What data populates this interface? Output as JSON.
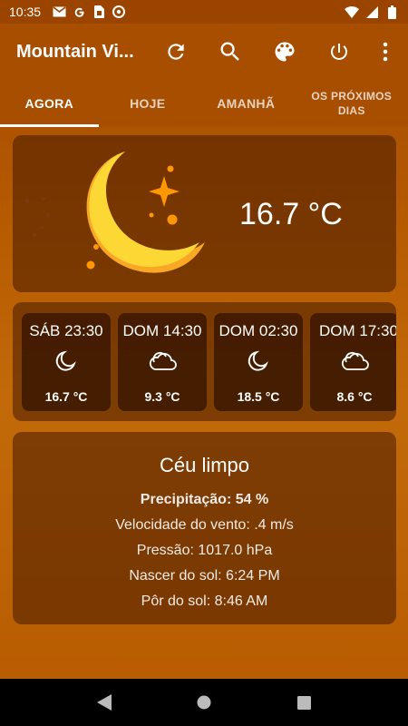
{
  "status_bar": {
    "time": "10:35",
    "icons": [
      "gmail-icon",
      "google-icon",
      "sim-card-icon",
      "do-not-disturb-icon"
    ],
    "right_icons": [
      "wifi-icon",
      "signal-icon",
      "battery-icon"
    ]
  },
  "app_bar": {
    "title": "Mountain Vi...",
    "actions": [
      "refresh-icon",
      "search-icon",
      "palette-icon",
      "power-icon",
      "more-vert-icon"
    ]
  },
  "tabs": [
    {
      "label": "AGORA",
      "active": true
    },
    {
      "label": "HOJE",
      "active": false
    },
    {
      "label": "AMANHÃ",
      "active": false
    },
    {
      "label": "OS PRÓXIMOS DIAS",
      "active": false
    }
  ],
  "current": {
    "icon": "moon-stars-icon",
    "temperature": "16.7 °C"
  },
  "forecast": [
    {
      "time": "SÁB 23:30",
      "icon": "moon-icon",
      "temp": "16.7 °C"
    },
    {
      "time": "DOM 14:30",
      "icon": "cloud-icon",
      "temp": "9.3 °C"
    },
    {
      "time": "DOM 02:30",
      "icon": "moon-icon",
      "temp": "18.5 °C"
    },
    {
      "time": "DOM 17:30",
      "icon": "cloud-icon",
      "temp": "8.6 °C"
    }
  ],
  "details": {
    "condition": "Céu limpo",
    "precipitation": "Precipitação: 54 %",
    "wind": "Velocidade do vento: .4 m/s",
    "pressure": "Pressão: 1017.0 hPa",
    "sunrise": "Nascer do sol: 6:24 PM",
    "sunset": "Pôr do sol: 8:46 AM"
  },
  "colors": {
    "moon": "#fdd835",
    "moon_shadow": "#f9a825",
    "star": "#ff9800",
    "appbar": "#a84e00"
  }
}
